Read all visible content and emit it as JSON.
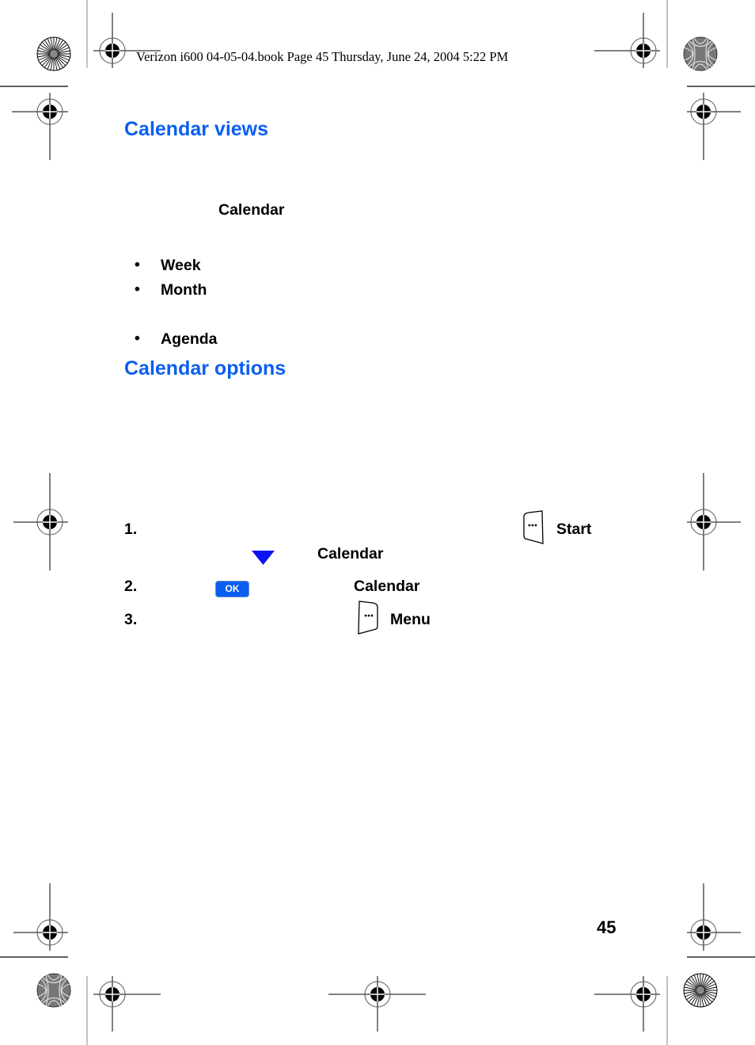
{
  "header": {
    "text": "Verizon i600 04-05-04.book  Page 45  Thursday, June 24, 2004  5:22 PM"
  },
  "sections": {
    "calendar_views": {
      "title": "Calendar views",
      "app_label": "Calendar",
      "views": [
        {
          "bullet": "•",
          "label": "Week"
        },
        {
          "bullet": "•",
          "label": "Month"
        },
        {
          "bullet": "•",
          "label": "Agenda"
        }
      ]
    },
    "calendar_options": {
      "title": "Calendar options",
      "steps": [
        {
          "number": "1.",
          "softkey_label": "Start",
          "nav_icon": "down-arrow-icon",
          "target": "Calendar"
        },
        {
          "number": "2.",
          "button_label": "OK",
          "target": "Calendar"
        },
        {
          "number": "3.",
          "softkey_label": "Menu"
        }
      ]
    }
  },
  "footer": {
    "page_number": "45"
  },
  "colors": {
    "heading_blue": "#0a5ef0",
    "arrow_blue": "#0a14f0"
  }
}
